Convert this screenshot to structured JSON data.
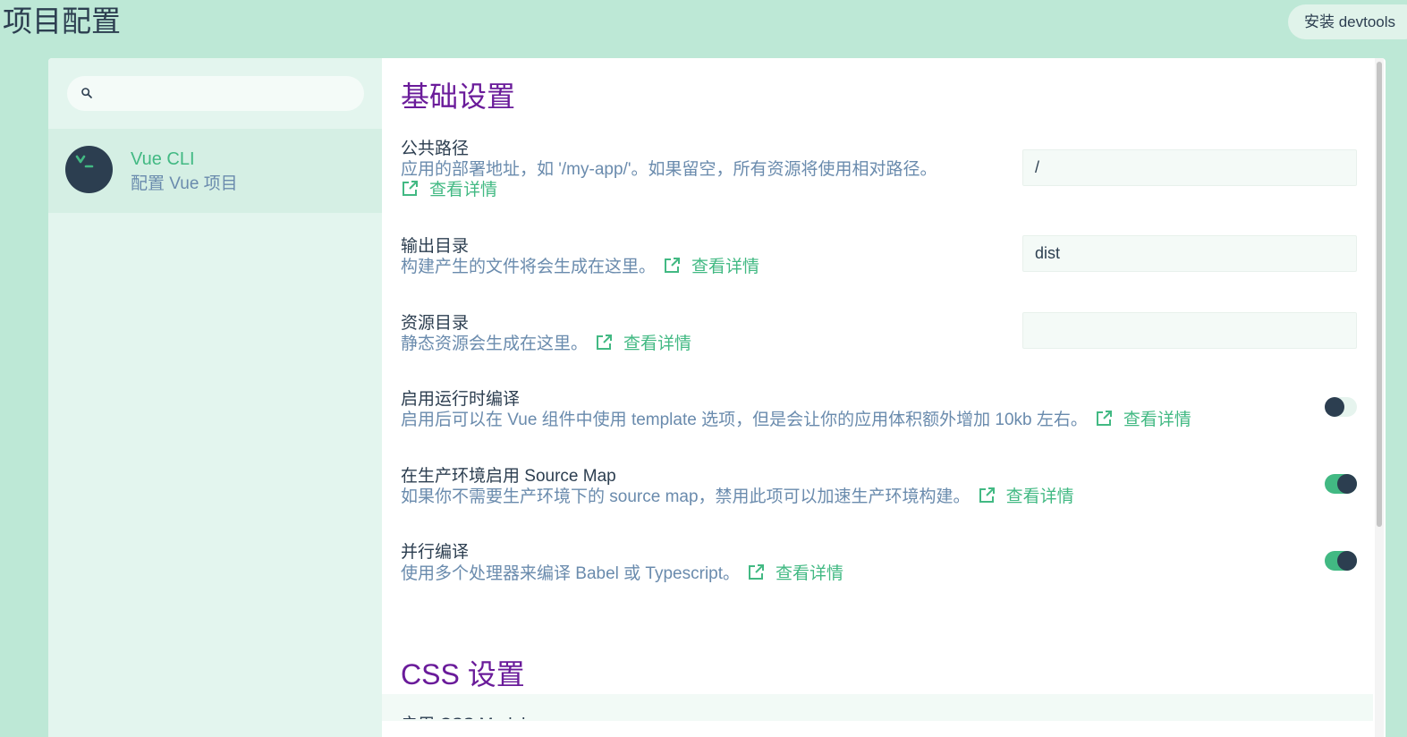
{
  "header": {
    "title": "项目配置",
    "devtools_label": "安装 devtools"
  },
  "sidebar": {
    "search": {
      "value": "",
      "placeholder": ""
    },
    "plugins": [
      {
        "name": "Vue CLI",
        "description": "配置 Vue 项目"
      }
    ]
  },
  "main": {
    "sections": [
      {
        "title": "基础设置",
        "rows": [
          {
            "label": "公共路径",
            "description": "应用的部署地址，如 '/my-app/'。如果留空，所有资源将使用相对路径。",
            "link": "查看详情",
            "input_value": "/"
          },
          {
            "label": "输出目录",
            "description": "构建产生的文件将会生成在这里。",
            "link": "查看详情",
            "input_value": "dist"
          },
          {
            "label": "资源目录",
            "description": "静态资源会生成在这里。",
            "link": "查看详情",
            "input_value": ""
          },
          {
            "label": "启用运行时编译",
            "description": "启用后可以在 Vue 组件中使用 template 选项，但是会让你的应用体积额外增加 10kb 左右。",
            "link": "查看详情",
            "toggle_on": false
          },
          {
            "label": "在生产环境启用 Source Map",
            "description": "如果你不需要生产环境下的 source map，禁用此项可以加速生产环境构建。",
            "link": "查看详情",
            "toggle_on": true
          },
          {
            "label": "并行编译",
            "description": "使用多个处理器来编译 Babel 或 Typescript。",
            "link": "查看详情",
            "toggle_on": true
          }
        ]
      },
      {
        "title": "CSS 设置",
        "rows": [
          {
            "label": "启用 CSS Modules"
          }
        ]
      }
    ]
  },
  "colors": {
    "background": "#bde8d6",
    "accent": "#42b983",
    "section_title": "#6a1b9a",
    "text": "#2c3e50",
    "muted": "#6a8bad"
  },
  "icons": {
    "search": "search-icon",
    "external_link": "external-link-icon",
    "plugin_logo": "terminal-icon"
  }
}
